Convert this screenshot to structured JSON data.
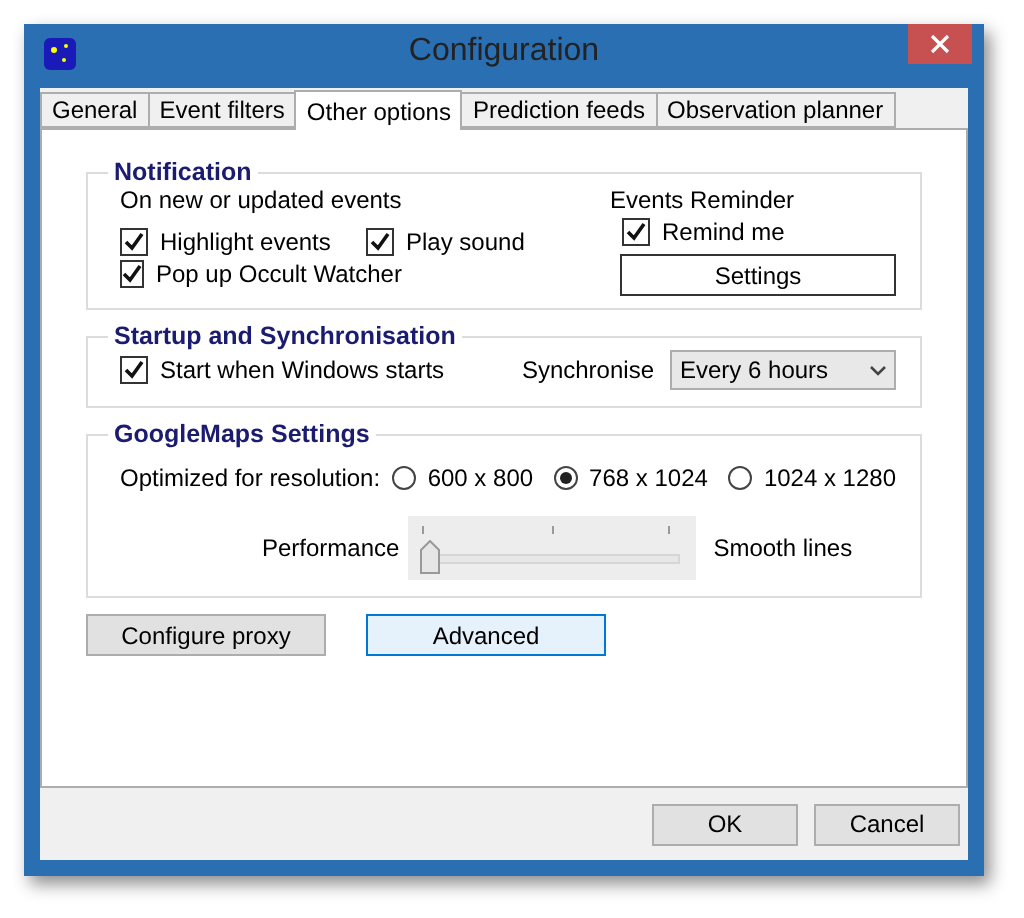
{
  "window": {
    "title": "Configuration"
  },
  "tabs": [
    {
      "label": "General",
      "selected": false
    },
    {
      "label": "Event filters",
      "selected": false
    },
    {
      "label": "Other options",
      "selected": true
    },
    {
      "label": "Prediction feeds",
      "selected": false
    },
    {
      "label": "Observation planner",
      "selected": false
    }
  ],
  "notification": {
    "title": "Notification",
    "subtitle": "On new or updated events",
    "options": [
      {
        "label": "Highlight events",
        "checked": true
      },
      {
        "label": "Play sound",
        "checked": true
      },
      {
        "label": "Pop up Occult Watcher",
        "checked": true
      }
    ],
    "reminder": {
      "title": "Events Reminder",
      "label": "Remind me",
      "checked": true,
      "button": "Settings"
    }
  },
  "startup": {
    "title": "Startup and Synchronisation",
    "option": {
      "label": "Start when Windows starts",
      "checked": true
    },
    "sync_label": "Synchronise",
    "sync_value": "Every 6 hours"
  },
  "googlemaps": {
    "title": "GoogleMaps Settings",
    "resolution_label": "Optimized for resolution:",
    "resolutions": [
      {
        "label": "600 x 800",
        "selected": false
      },
      {
        "label": "768 x 1024",
        "selected": true
      },
      {
        "label": "1024 x 1280",
        "selected": false
      }
    ],
    "slider": {
      "left_label": "Performance",
      "right_label": "Smooth lines",
      "level": 0
    }
  },
  "buttons": [
    {
      "label": "Configure proxy",
      "highlighted": false
    },
    {
      "label": "Advanced",
      "highlighted": true
    }
  ],
  "dialog_buttons": [
    "OK",
    "Cancel"
  ]
}
